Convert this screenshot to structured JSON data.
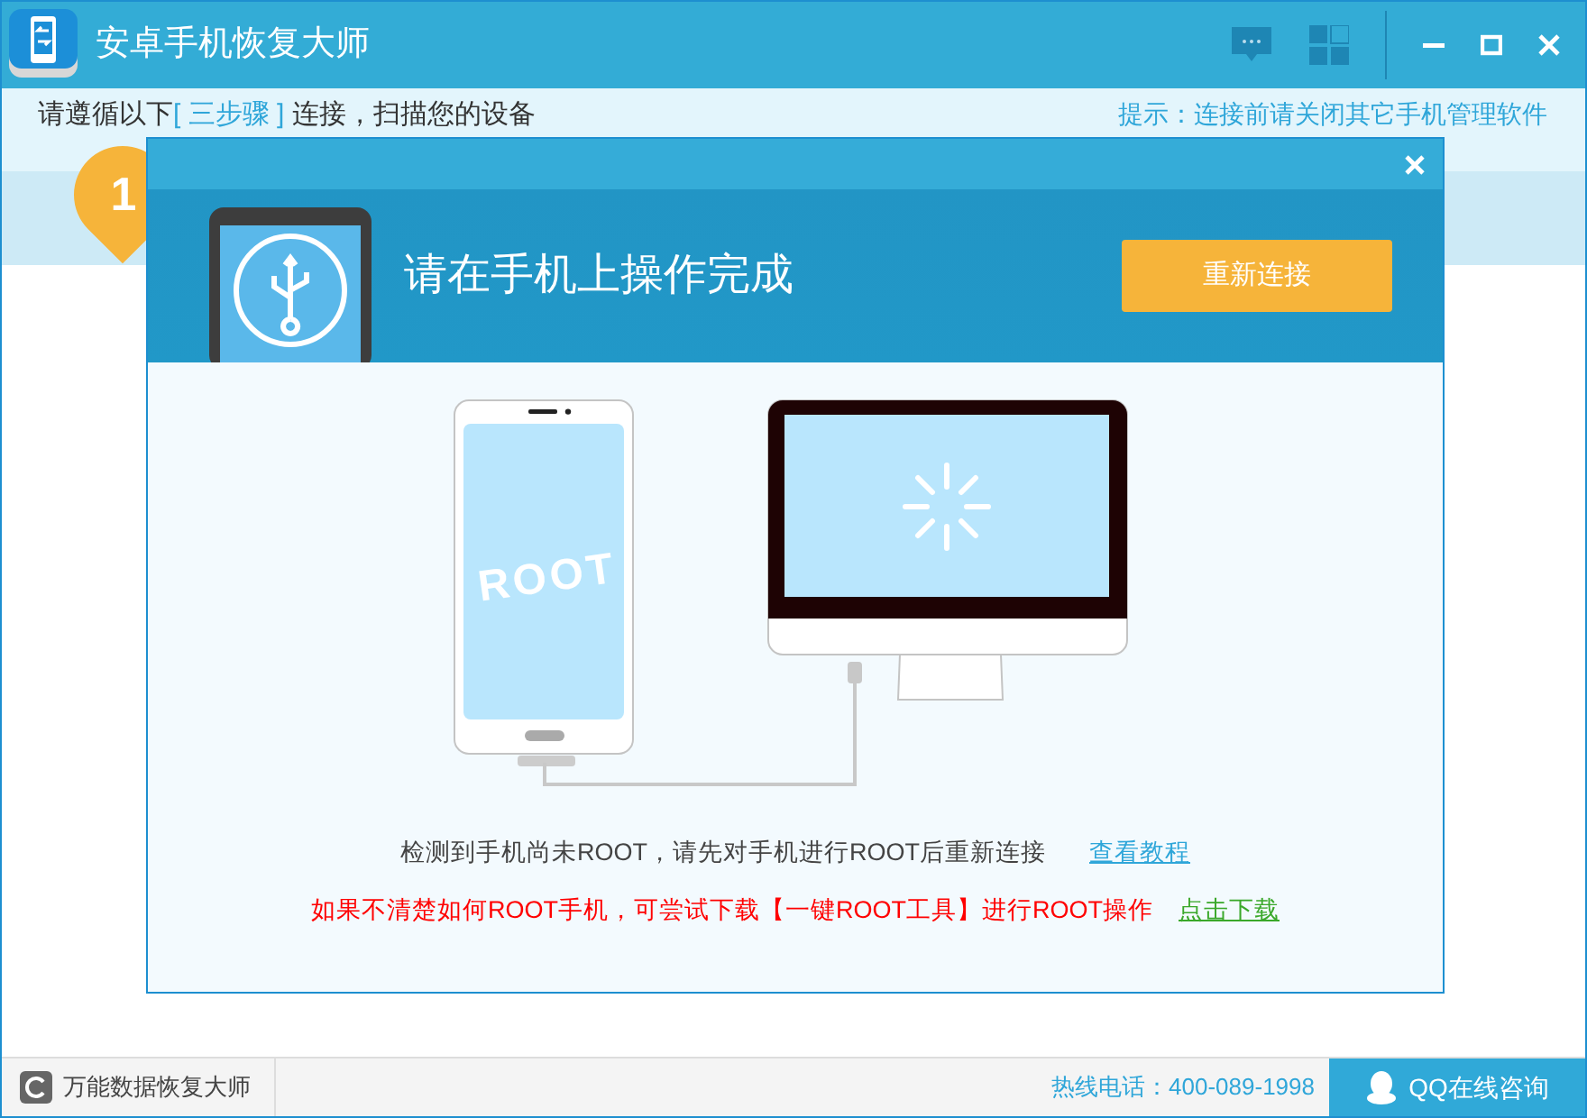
{
  "window": {
    "title": "安卓手机恢复大师"
  },
  "guide": {
    "prefix": "请遵循以下",
    "highlight": "[ 三步骤 ]",
    "suffix": " 连接，扫描您的设备",
    "tip": "提示：连接前请关闭其它手机管理软件",
    "step": "1"
  },
  "dialog": {
    "heading": "请在手机上操作完成",
    "reconnect_button": "重新连接",
    "phone_screen_text": "ROOT",
    "message": "检测到手机尚未ROOT，请先对手机进行ROOT后重新连接",
    "tutorial_link": "查看教程",
    "warning": "如果不清楚如何ROOT手机，可尝试下载【一键ROOT工具】进行ROOT操作",
    "download_link": "点击下载"
  },
  "status_bar": {
    "app": "万能数据恢复大师",
    "hotline": "热线电话：400-089-1998",
    "qq_button": "QQ在线咨询"
  }
}
